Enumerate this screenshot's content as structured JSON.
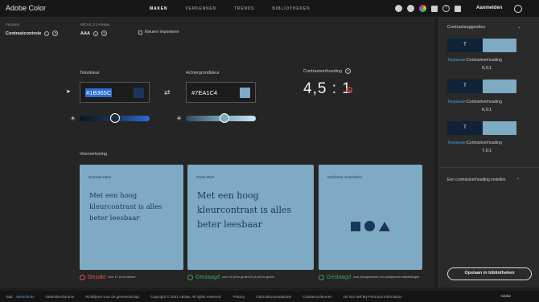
{
  "app": {
    "title": "Adobe Color"
  },
  "nav": {
    "items": [
      "MAKEN",
      "VERKENNEN",
      "TRENDS",
      "BIBLIOTHEKEN"
    ],
    "active": "MAKEN"
  },
  "header": {
    "signin": "Aanmelden"
  },
  "toolbar": {
    "functions_label": "Functies",
    "functions_value": "Contrastcontrole",
    "wcag_label": "WCAG 2.1-niveau",
    "wcag_value": "AAA",
    "import_label": "Kleuren importeren"
  },
  "text_color": {
    "label": "Tekstkleur",
    "hex": "#1B365C",
    "swatch": "#1B365C"
  },
  "background_color": {
    "label": "Achtergrondkleur",
    "hex": "#7EA1C4",
    "swatch": "#7EAAC4"
  },
  "contrast": {
    "label": "Contrastverhouding",
    "value": "4,5 : 1"
  },
  "preview": {
    "label": "Voorvertoning",
    "cards": [
      {
        "caption": "Normale tekst",
        "text": "Met een hoog kleurcontrast is alles beter leesbaar"
      },
      {
        "caption": "Grote tekst",
        "text": "Met een hoog kleurcontrast is alles beter leesbaar"
      },
      {
        "caption": "Grafische onderdelen"
      }
    ],
    "statuses": [
      {
        "status": "Gezakt",
        "note": "voor 17 pt en kleiner"
      },
      {
        "status": "Geslaagd",
        "note": "voor 18 pt en groter/14 pt vet en groter"
      },
      {
        "status": "Geslaagd",
        "note": "voor pictogrammen en scheppende afbeeldingen"
      }
    ]
  },
  "suggestions": {
    "title": "Contrastsuggesties",
    "items": [
      {
        "sample": "T",
        "link": "Toepassen",
        "label": "Contrastverhouding",
        "ratio": "6,0:1"
      },
      {
        "sample": "T",
        "link": "Toepassen",
        "label": "Contrastverhouding",
        "ratio": "6,0:1"
      },
      {
        "sample": "T",
        "link": "Toepassen",
        "label": "Contrastverhouding",
        "ratio": "7,0:1"
      }
    ],
    "set_link": "Een contrastverhouding instellen",
    "save_button": "Opslaan in bibliotheken"
  },
  "footer": {
    "lang_label": "Taal:",
    "lang_value": "Nederlands",
    "links": [
      "Gebruikersforums",
      "Richtlijnen voor de gemeenschap",
      "Copyright © 2021 Adobe. All rights reserved.",
      "Privacy",
      "Gebruiksvoorwaarden",
      "Cookievoorkeuren",
      "Do Not Sell My Personal Information"
    ],
    "brand": "Adobe"
  },
  "colors": {
    "accent": "#2B6BD6",
    "pass": "#3FA34D",
    "fail": "#E2574C",
    "text": "#1B365C",
    "background": "#7EAAC4"
  },
  "sliders": {
    "text_brightness": 0.5,
    "background_brightness": 0.55
  }
}
